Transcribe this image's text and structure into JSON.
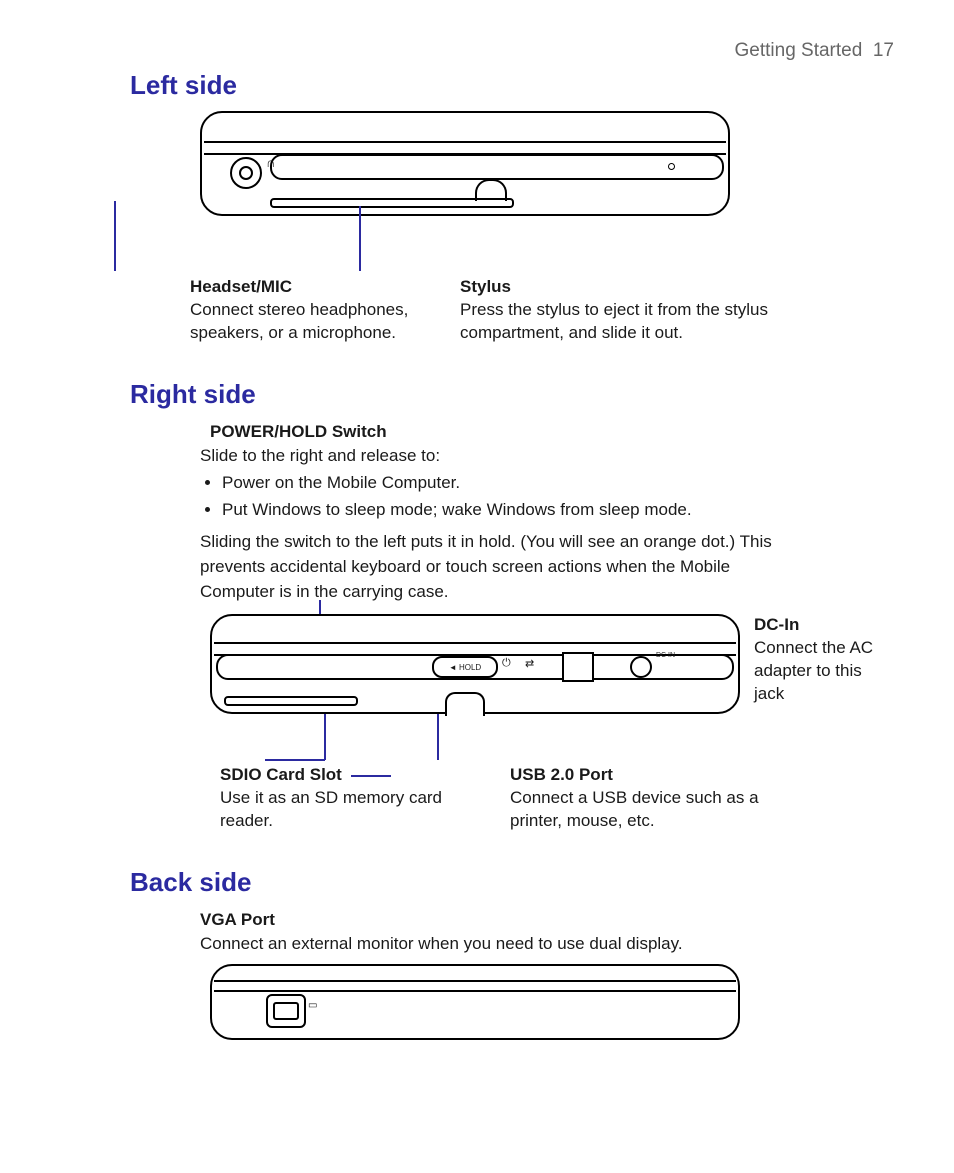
{
  "header": {
    "section": "Getting Started",
    "page": "17"
  },
  "left": {
    "heading": "Left side",
    "headset": {
      "title": "Headset/MIC",
      "desc": "Connect stereo headphones, speakers, or a microphone."
    },
    "stylus": {
      "title": "Stylus",
      "desc": "Press the stylus to eject it from the stylus compartment, and slide it out."
    },
    "icon_label": "♫"
  },
  "right": {
    "heading": "Right side",
    "power": {
      "title": "POWER/HOLD Switch",
      "intro": "Slide to the right and release to:",
      "bullet1": "Power on the Mobile Computer.",
      "bullet2": "Put Windows to sleep mode; wake Windows from sleep mode.",
      "hold_desc": "Sliding the switch to the left puts it in hold. (You will see an orange dot.) This prevents accidental keyboard or touch screen actions when the Mobile Computer is in the carrying case."
    },
    "sd": {
      "title": "SDIO Card Slot",
      "desc": "Use it as an SD memory card reader."
    },
    "usb": {
      "title": "USB 2.0 Port",
      "desc": "Connect a USB device such as a printer, mouse, etc."
    },
    "dcin": {
      "title": "DC-In",
      "desc": "Connect the AC adapter to this jack"
    },
    "hold_label": "◄ HOLD",
    "dc_small": "DC IN"
  },
  "back": {
    "heading": "Back side",
    "vga": {
      "title": "VGA Port",
      "desc": "Connect an external monitor when you need to use dual display."
    }
  }
}
